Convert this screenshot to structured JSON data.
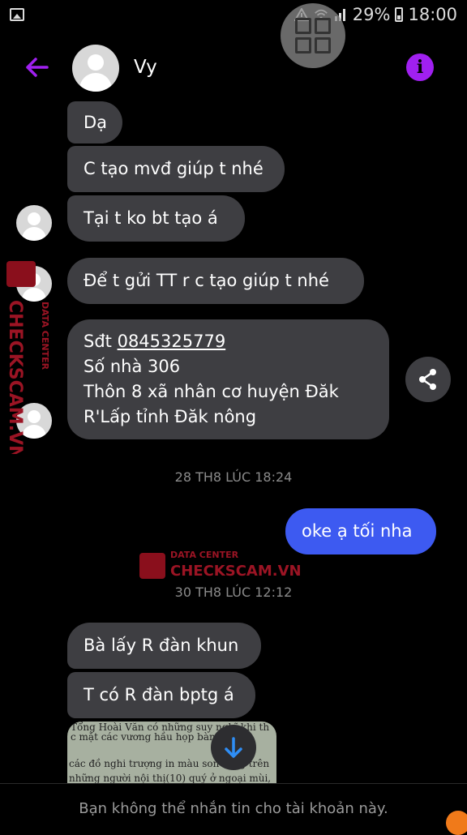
{
  "status_bar": {
    "battery": "29%",
    "time": "18:00"
  },
  "header": {
    "contact_name": "Vy"
  },
  "messages": [
    {
      "text": "Dạ",
      "dir": "in"
    },
    {
      "text": "C tạo mvđ giúp t nhé",
      "dir": "in"
    },
    {
      "text": "Tại t ko bt tạo á",
      "dir": "in"
    },
    {
      "text": "Để t gửi TT r c tạo giúp t nhé",
      "dir": "in"
    },
    {
      "lines": [
        "Sđt ",
        "0845325779",
        "Số nhà 306",
        "Thôn 8 xã nhân cơ huyện Đăk",
        "R'Lấp tỉnh Đăk nông"
      ],
      "dir": "in"
    },
    {
      "text": "oke ạ tối nha",
      "dir": "out"
    },
    {
      "text": "Bà lấy R đàn khun",
      "dir": "in"
    },
    {
      "text": "T có R đàn bptg á",
      "dir": "in"
    }
  ],
  "timestamps": [
    "28 TH8 LÚC 18:24",
    "30 TH8 LÚC 12:12"
  ],
  "photo_lines": [
    "Tổng    Hoài Văn có những suy nghĩ khi th",
    "c mặt    các vương hầu họp bàn?",
    "các đồ nghi trượng in màu son sáng trên",
    "những người nội thị(10) quý ở ngoại mùi,"
  ],
  "footer": {
    "notice": "Bạn không thể nhắn tin cho tài khoản này."
  },
  "watermark": {
    "line1": "DATA CENTER",
    "line2": "CHECKSCAM.VN"
  },
  "colors": {
    "accent": "#a020f0",
    "outgoing": "#3d5af1",
    "incoming": "#3e3e42",
    "link": "#2f8ef5"
  }
}
